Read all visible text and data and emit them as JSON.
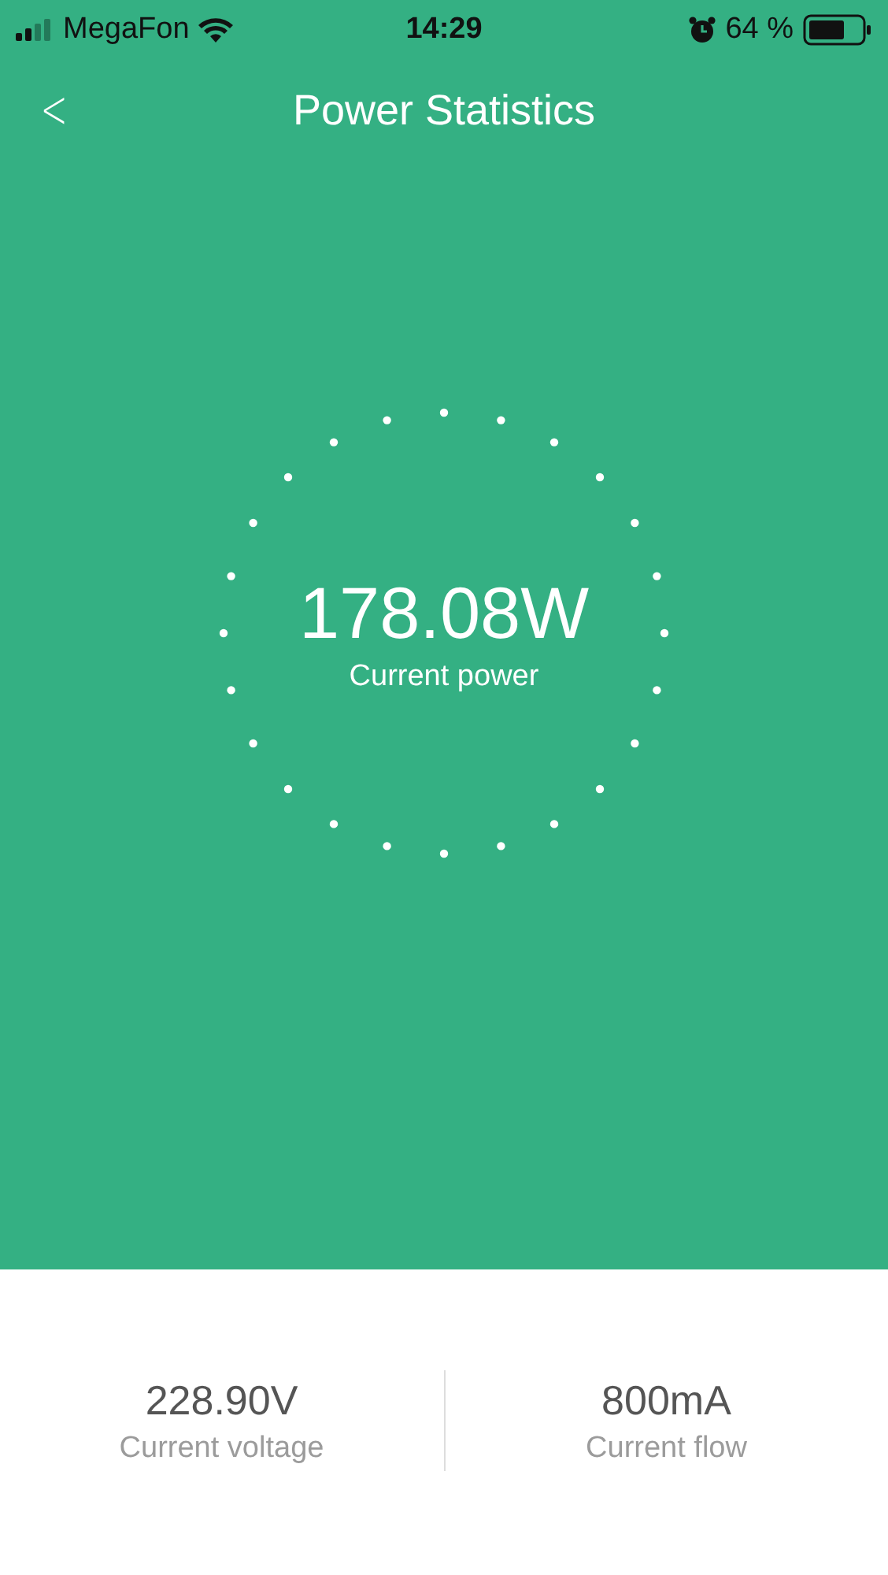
{
  "status_bar": {
    "carrier": "MegaFon",
    "time": "14:29",
    "battery": "64 %"
  },
  "header": {
    "back": "<",
    "title": "Power Statistics"
  },
  "gauge": {
    "value": "178.08W",
    "label": "Current power"
  },
  "stats": [
    {
      "value": "228.90V",
      "label": "Current voltage"
    },
    {
      "value": "800mA",
      "label": "Current flow"
    }
  ]
}
